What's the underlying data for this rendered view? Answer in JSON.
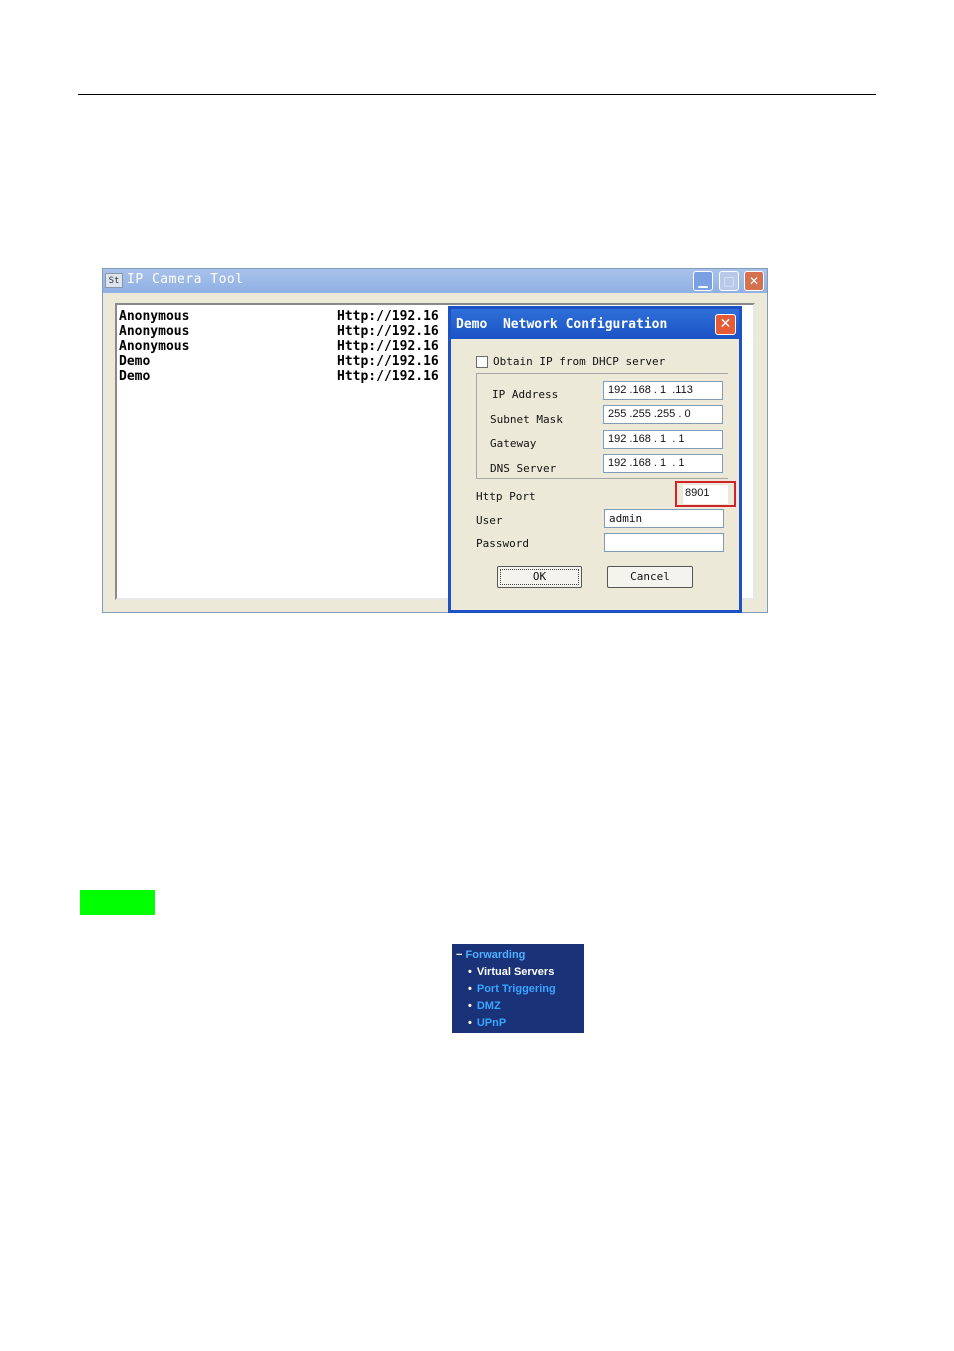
{
  "window": {
    "icon_text": "St",
    "title": "IP Camera Tool",
    "minimize_glyph": "▁",
    "maximize_glyph": "□",
    "close_glyph": "✕",
    "devices": [
      {
        "name": "Anonymous",
        "url": "Http://192.16"
      },
      {
        "name": "Anonymous",
        "url": "Http://192.16"
      },
      {
        "name": "Anonymous",
        "url": "Http://192.16"
      },
      {
        "name": "Demo",
        "url": "Http://192.16"
      },
      {
        "name": "Demo",
        "url": "Http://192.16"
      }
    ]
  },
  "dialog": {
    "title": "Demo  Network Configuration",
    "close_glyph": "✕",
    "dhcp_label": "Obtain IP from DHCP server",
    "dhcp_checked": false,
    "ip_label": "IP Address",
    "ip_value": "192 .168 . 1  .113",
    "mask_label": "Subnet Mask",
    "mask_value": "255 .255 .255 . 0",
    "gateway_label": "Gateway",
    "gateway_value": "192 .168 . 1  . 1",
    "dns_label": "DNS Server",
    "dns_value": "192 .168 . 1  . 1",
    "port_label": "Http Port",
    "port_value": "8901",
    "user_label": "User",
    "user_value": "admin",
    "password_label": "Password",
    "password_value": "",
    "ok_label": "OK",
    "cancel_label": "Cancel",
    "highlight_color": "#d0232a"
  },
  "highlight_block_color": "#00ff00",
  "router_menu": {
    "background": "#1a3378",
    "header_sign": "−",
    "header": "Forwarding",
    "items": [
      {
        "label": "Virtual Servers",
        "active": true
      },
      {
        "label": "Port Triggering",
        "active": false
      },
      {
        "label": "DMZ",
        "active": false
      },
      {
        "label": "UPnP",
        "active": false
      }
    ]
  }
}
